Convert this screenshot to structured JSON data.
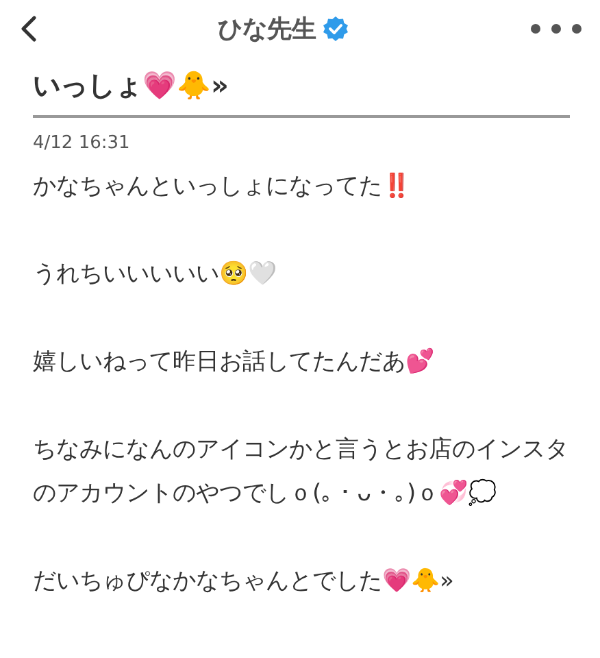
{
  "header": {
    "title": "ひな先生",
    "verified": true
  },
  "post": {
    "title": "いっしょ💗🐥»",
    "date": "4/12 16:31",
    "paragraphs": [
      "かなちゃんといっしょになってた‼️",
      "うれちいいいいい🥺🤍",
      "嬉しいねって昨日お話してたんだあ💕",
      "ちなみになんのアイコンかと言うとお店のインスタのアカウントのやつでしｏ(｡・ᴗ・｡)ｏ💞💭",
      "だいちゅぴなかなちゃんとでした💗🐥»"
    ]
  }
}
